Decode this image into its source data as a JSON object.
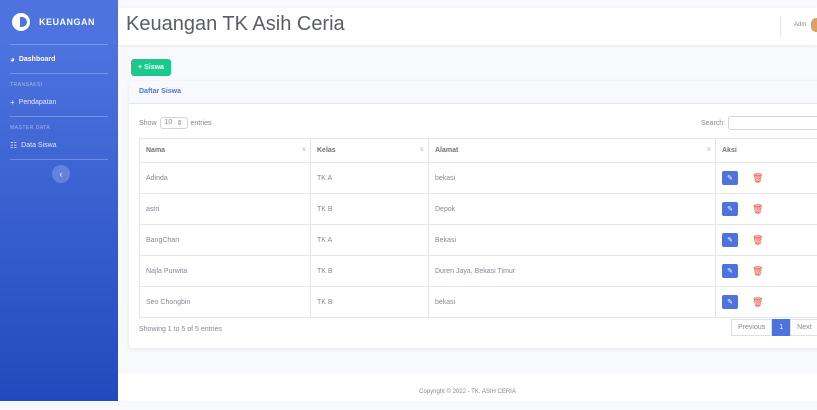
{
  "sidebar": {
    "brand": "KEUANGAN",
    "dashboard": "Dashboard",
    "section1": "TRANSAKSI",
    "pendapatan": "Pendapatan",
    "section2": "MASTER DATA",
    "data_siswa": "Data Siswa",
    "toggle_icon": "chevron-left-icon",
    "colors": {
      "gradient_top": "#4e73df",
      "gradient_bottom": "#224abe"
    }
  },
  "topbar": {
    "title": "Keuangan TK Asih Ceria",
    "user": "Adm"
  },
  "toolbar": {
    "add_label": "Siswa"
  },
  "card": {
    "title": "Daftar Siswa"
  },
  "table_controls": {
    "show_label": "Show",
    "entries_value": "10",
    "entries_label": "entries",
    "search_label": "Search:"
  },
  "table": {
    "headers": [
      "Nama",
      "Kelas",
      "Alamat",
      "Aksi"
    ],
    "rows": [
      {
        "nama": "Adinda",
        "kelas": "TK A",
        "alamat": "bekasi"
      },
      {
        "nama": "astri",
        "kelas": "TK B",
        "alamat": "Depok"
      },
      {
        "nama": "BangChan",
        "kelas": "TK A",
        "alamat": "Bekasi"
      },
      {
        "nama": "Najla Purwita",
        "kelas": "TK B",
        "alamat": "Duren Jaya, Bekasi Timur"
      },
      {
        "nama": "Seo Chongbin",
        "kelas": "TK B",
        "alamat": "bekasi"
      }
    ]
  },
  "footer_info": {
    "showing": "Showing 1 to 5 of 5 entries"
  },
  "pagination": {
    "previous": "Previous",
    "current": "1",
    "next": "Next"
  },
  "footer": {
    "copyright": "Copyright © 2022 - TK. ASIH CERIA"
  },
  "colors": {
    "accent": "#4e73df",
    "success": "#1cc88a",
    "danger": "#e74a3b"
  }
}
